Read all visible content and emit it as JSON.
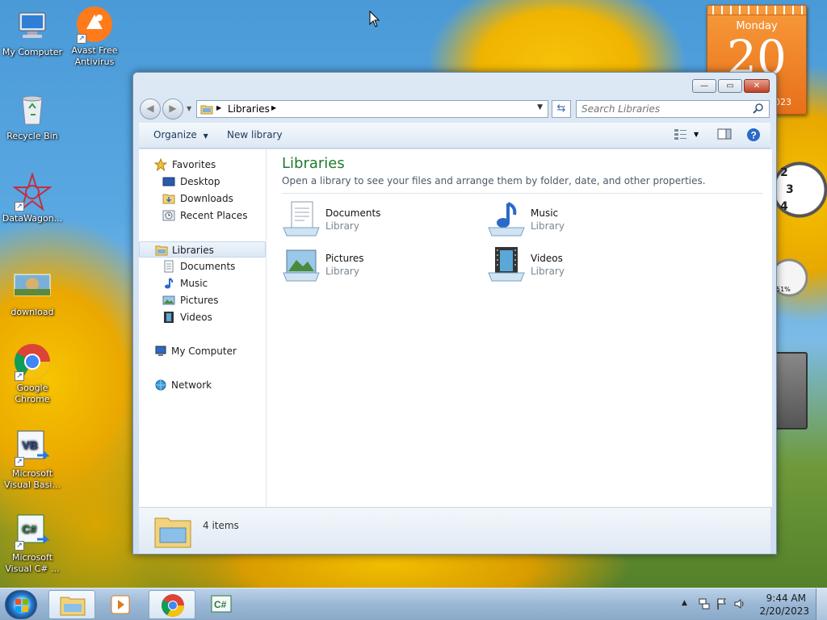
{
  "desktop": {
    "icons": [
      {
        "label": "My Computer",
        "icon": "computer-icon"
      },
      {
        "label": "Avast Free Antivirus",
        "icon": "avast-icon"
      },
      {
        "label": "Recycle Bin",
        "icon": "recycle-bin-icon"
      },
      {
        "label": "DataWagon...",
        "icon": "datawagon-icon"
      },
      {
        "label": "download",
        "icon": "image-file-icon"
      },
      {
        "label": "Google Chrome",
        "icon": "chrome-icon"
      },
      {
        "label": "Microsoft Visual Basi...",
        "icon": "visual-basic-icon"
      },
      {
        "label": "Microsoft Visual C# ...",
        "icon": "visual-csharp-icon"
      }
    ]
  },
  "gadgets": {
    "calendar": {
      "weekday": "Monday",
      "day": "20",
      "year": "2023"
    },
    "clock": {
      "numbers": [
        "2",
        "3",
        "4"
      ]
    },
    "meter": {
      "value": "51%"
    }
  },
  "window": {
    "controls": {
      "minimize": "—",
      "maximize": "▭",
      "close": "✕"
    },
    "address": {
      "segments": [
        "Libraries"
      ]
    },
    "search": {
      "placeholder": "Search Libraries"
    },
    "toolbar": {
      "organize": "Organize",
      "new_library": "New library"
    },
    "nav": {
      "favorites": "Favorites",
      "favorites_items": [
        "Desktop",
        "Downloads",
        "Recent Places"
      ],
      "libraries": "Libraries",
      "libraries_items": [
        "Documents",
        "Music",
        "Pictures",
        "Videos"
      ],
      "computer": "My Computer",
      "network": "Network"
    },
    "main": {
      "title": "Libraries",
      "subtitle": "Open a library to see your files and arrange them by folder, date, and other properties.",
      "items": [
        {
          "name": "Documents",
          "type": "Library",
          "icon": "documents-library-icon"
        },
        {
          "name": "Music",
          "type": "Library",
          "icon": "music-library-icon"
        },
        {
          "name": "Pictures",
          "type": "Library",
          "icon": "pictures-library-icon"
        },
        {
          "name": "Videos",
          "type": "Library",
          "icon": "videos-library-icon"
        }
      ]
    },
    "status": {
      "text": "4 items"
    }
  },
  "taskbar": {
    "apps": [
      "Windows Explorer",
      "Windows Media Player",
      "Google Chrome",
      "Visual C#"
    ],
    "time": "9:44 AM",
    "date": "2/20/2023"
  },
  "colors": {
    "title_green": "#1e7a2c",
    "calendar_orange": "#e8701a",
    "link_blue": "#1e395b"
  }
}
